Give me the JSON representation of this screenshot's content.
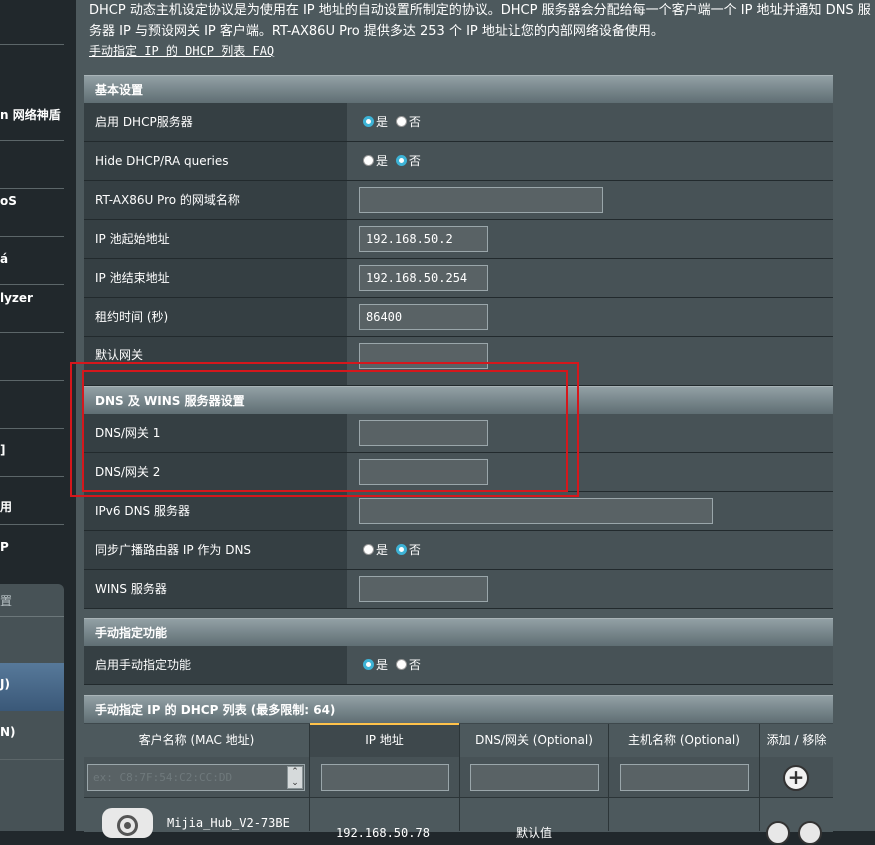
{
  "sidebar": {
    "items": [
      "n 网络神盾",
      "oS",
      "á",
      "lyzer",
      "]",
      "用",
      "P"
    ],
    "lower_items": [
      "置",
      "J)",
      "N)"
    ]
  },
  "intro": {
    "text": "DHCP 动态主机设定协议是为使用在 IP 地址的自动设置所制定的协议。DHCP 服务器会分配给每一个客户端一个 IP 地址并通知 DNS 服务器 IP 与预设网关 IP 客户端。RT-AX86U Pro 提供多达 253 个 IP 地址让您的内部网络设备使用。",
    "faq_link": "手动指定 IP 的 DHCP 列表 FAQ"
  },
  "basic": {
    "title": "基本设置",
    "enable_dhcp": "启用 DHCP服务器",
    "hide_dhcp": "Hide DHCP/RA queries",
    "domain_name": "RT-AX86U Pro 的网域名称",
    "ip_start": "IP 池起始地址",
    "ip_start_value": "192.168.50.2",
    "ip_end": "IP 池结束地址",
    "ip_end_value": "192.168.50.254",
    "lease": "租约时间 (秒)",
    "lease_value": "86400",
    "gateway": "默认网关"
  },
  "radio": {
    "yes": "是",
    "no": "否"
  },
  "dns": {
    "title": "DNS 及 WINS 服务器设置",
    "dns1": "DNS/网关 1",
    "dns2": "DNS/网关 2",
    "ipv6_dns": "IPv6 DNS 服务器",
    "sync_dns": "同步广播路由器 IP 作为 DNS",
    "wins": "WINS 服务器"
  },
  "manual": {
    "title": "手动指定功能",
    "enable": "启用手动指定功能"
  },
  "list": {
    "title": "手动指定 IP 的 DHCP 列表 (最多限制:  64)",
    "columns": [
      "客户名称 (MAC 地址)",
      "IP 地址",
      "DNS/网关 (Optional)",
      "主机名称 (Optional)",
      "添加 / 移除"
    ],
    "mac_placeholder": "ex: C8:7F:54:C2:CC:DD",
    "entry_name": "Mijia_Hub_V2-73BE",
    "entry_ip": "192.168.50.78",
    "entry_dns": "默认值"
  },
  "colors": {
    "accent": "#3db3d6",
    "highlight": "#d5171c",
    "tab_line": "#ffc24a"
  }
}
